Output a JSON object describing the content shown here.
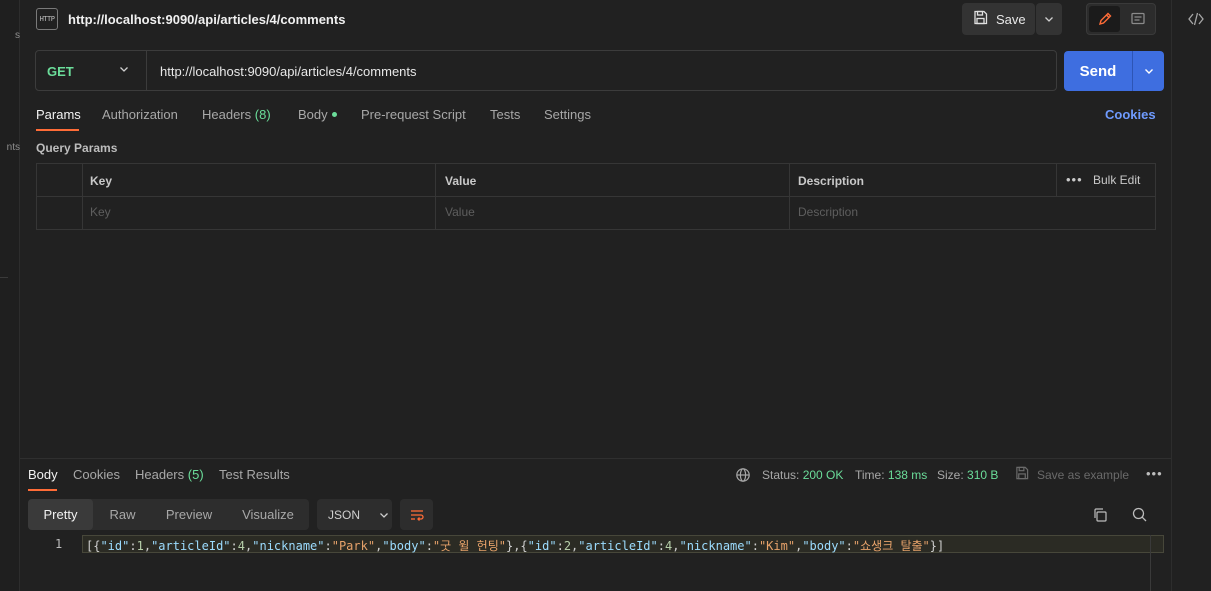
{
  "left_sidebar": {
    "fragments": [
      "s",
      "nts"
    ]
  },
  "request": {
    "icon_label": "HTTP",
    "title": "http://localhost:9090/api/articles/4/comments",
    "method": "GET",
    "url": "http://localhost:9090/api/articles/4/comments"
  },
  "toolbar": {
    "save_label": "Save",
    "send_label": "Send"
  },
  "request_tabs": {
    "params": "Params",
    "authorization": "Authorization",
    "headers": "Headers",
    "headers_count": "(8)",
    "body": "Body",
    "pre_request": "Pre-request Script",
    "tests": "Tests",
    "settings": "Settings",
    "cookies": "Cookies"
  },
  "query_params": {
    "title": "Query Params",
    "columns": {
      "key": "Key",
      "value": "Value",
      "description": "Description"
    },
    "bulk_edit": "Bulk Edit",
    "more": "•••",
    "placeholders": {
      "key": "Key",
      "value": "Value",
      "description": "Description"
    }
  },
  "response": {
    "tabs": {
      "body": "Body",
      "cookies": "Cookies",
      "headers": "Headers",
      "headers_count": "(5)",
      "test_results": "Test Results"
    },
    "status_label": "Status:",
    "status_value": "200 OK",
    "time_label": "Time:",
    "time_value": "138 ms",
    "size_label": "Size:",
    "size_value": "310 B",
    "save_example": "Save as example",
    "more": "•••",
    "views": [
      "Pretty",
      "Raw",
      "Preview",
      "Visualize"
    ],
    "format": "JSON",
    "line_number": "1",
    "body_tokens": [
      {
        "t": "[{",
        "c": "p"
      },
      {
        "t": "\"id\"",
        "c": "key"
      },
      {
        "t": ":",
        "c": "p"
      },
      {
        "t": "1",
        "c": "num"
      },
      {
        "t": ",",
        "c": "p"
      },
      {
        "t": "\"articleId\"",
        "c": "key"
      },
      {
        "t": ":",
        "c": "p"
      },
      {
        "t": "4",
        "c": "num"
      },
      {
        "t": ",",
        "c": "p"
      },
      {
        "t": "\"nickname\"",
        "c": "key"
      },
      {
        "t": ":",
        "c": "p"
      },
      {
        "t": "\"Park\"",
        "c": "str"
      },
      {
        "t": ",",
        "c": "p"
      },
      {
        "t": "\"body\"",
        "c": "key"
      },
      {
        "t": ":",
        "c": "p"
      },
      {
        "t": "\"굿 윌 헌팅\"",
        "c": "str"
      },
      {
        "t": "},{",
        "c": "p"
      },
      {
        "t": "\"id\"",
        "c": "key"
      },
      {
        "t": ":",
        "c": "p"
      },
      {
        "t": "2",
        "c": "num"
      },
      {
        "t": ",",
        "c": "p"
      },
      {
        "t": "\"articleId\"",
        "c": "key"
      },
      {
        "t": ":",
        "c": "p"
      },
      {
        "t": "4",
        "c": "num"
      },
      {
        "t": ",",
        "c": "p"
      },
      {
        "t": "\"nickname\"",
        "c": "key"
      },
      {
        "t": ":",
        "c": "p"
      },
      {
        "t": "\"Kim\"",
        "c": "str"
      },
      {
        "t": ",",
        "c": "p"
      },
      {
        "t": "\"body\"",
        "c": "key"
      },
      {
        "t": ":",
        "c": "p"
      },
      {
        "t": "\"쇼생크 탈출\"",
        "c": "str"
      },
      {
        "t": "}]",
        "c": "p"
      }
    ]
  },
  "colors": {
    "background": "#212121",
    "accent_orange": "#ff6c37",
    "send_blue": "#3e6ee0",
    "method_green": "#6bdd9a",
    "link_blue": "#6f9bff"
  },
  "icons": [
    "http-request-icon",
    "save-disk-icon",
    "chevron-down-icon",
    "pencil-icon",
    "comment-icon",
    "code-icon",
    "globe-icon",
    "save-example-icon",
    "wrap-lines-icon",
    "copy-icon",
    "search-icon"
  ]
}
